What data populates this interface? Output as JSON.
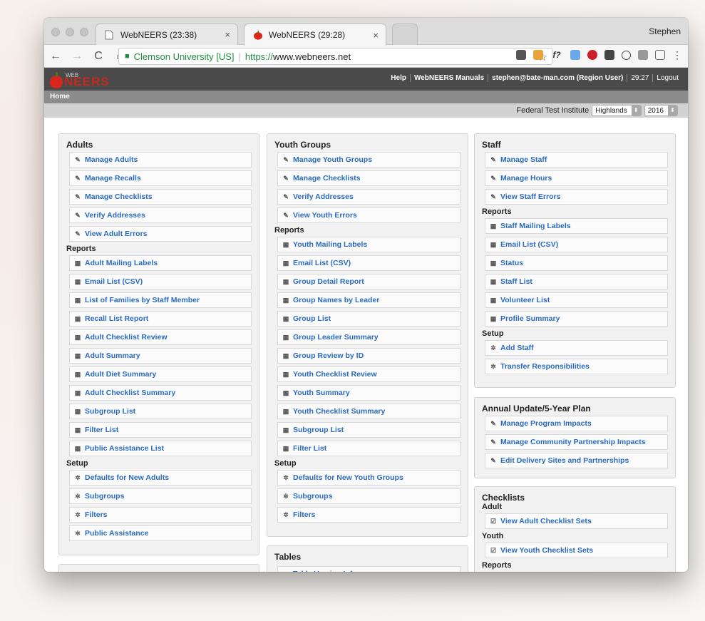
{
  "browser": {
    "tabs": [
      {
        "title": "WebNEERS (23:38)",
        "close": "×"
      },
      {
        "title": "WebNEERS (29:28)",
        "close": "×"
      }
    ],
    "user": "Stephen",
    "address": {
      "secure_label": "Clemson University [US]",
      "scheme": "https://",
      "host": "www.webneers.net"
    },
    "nav": {
      "back": "←",
      "forward": "→",
      "reload": "C",
      "home": "⌂"
    }
  },
  "app": {
    "logo_small": "WEB",
    "logo_text": "NEERS",
    "topnav": {
      "help": "Help",
      "manuals": "WebNEERS Manuals",
      "user": "stephen@bate-man.com (Region User)",
      "timer": "29:27",
      "logout": "Logout"
    },
    "breadcrumb": "Home",
    "context": {
      "institute": "Federal Test Institute",
      "region": "Highlands",
      "year": "2016"
    },
    "accent": "#2a6bc1",
    "header_bg": "#4a4a4a"
  },
  "panels": {
    "adults": {
      "title": "Adults",
      "manage": [
        "Manage Adults",
        "Manage Recalls",
        "Manage Checklists",
        "Verify Addresses",
        "View Adult Errors"
      ],
      "reports_label": "Reports",
      "reports": [
        "Adult Mailing Labels",
        "Email List (CSV)",
        "List of Families by Staff Member",
        "Recall List Report",
        "Adult Checklist Review",
        "Adult Summary",
        "Adult Diet Summary",
        "Adult Checklist Summary",
        "Subgroup List",
        "Filter List",
        "Public Assistance List"
      ],
      "setup_label": "Setup",
      "setup": [
        "Defaults for New Adults",
        "Subgroups",
        "Filters",
        "Public Assistance"
      ]
    },
    "youth": {
      "title": "Youth Groups",
      "manage": [
        "Manage Youth Groups",
        "Manage Checklists",
        "Verify Addresses",
        "View Youth Errors"
      ],
      "reports_label": "Reports",
      "reports": [
        "Youth Mailing Labels",
        "Email List (CSV)",
        "Group Detail Report",
        "Group Names by Leader",
        "Group List",
        "Group Leader Summary",
        "Group Review by ID",
        "Youth Checklist Review",
        "Youth Summary",
        "Youth Checklist Summary",
        "Subgroup List",
        "Filter List"
      ],
      "setup_label": "Setup",
      "setup": [
        "Defaults for New Youth Groups",
        "Subgroups",
        "Filters"
      ]
    },
    "staff": {
      "title": "Staff",
      "manage": [
        "Manage Staff",
        "Manage Hours",
        "View Staff Errors"
      ],
      "reports_label": "Reports",
      "reports": [
        "Staff Mailing Labels",
        "Email List (CSV)",
        "Status",
        "Staff List",
        "Volunteer List",
        "Profile Summary"
      ],
      "setup_label": "Setup",
      "setup": [
        "Add Staff",
        "Transfer Responsibilities"
      ]
    },
    "annual": {
      "title": "Annual Update/5-Year Plan",
      "items": [
        "Manage Program Impacts",
        "Manage Community Partnership Impacts",
        "Edit Delivery Sites and Partnerships"
      ]
    },
    "checklists": {
      "title": "Checklists",
      "adult_label": "Adult",
      "adult_items": [
        "View Adult Checklist Sets"
      ],
      "youth_label": "Youth",
      "youth_items": [
        "View Youth Checklist Sets"
      ],
      "reports_label": "Reports"
    },
    "tables": {
      "title": "Tables",
      "items": [
        "Table Version Info"
      ]
    }
  },
  "icons": {
    "manage": "pencil-icon",
    "report": "report-icon",
    "setup": "gear-icon",
    "checklist": "checklist-icon"
  }
}
